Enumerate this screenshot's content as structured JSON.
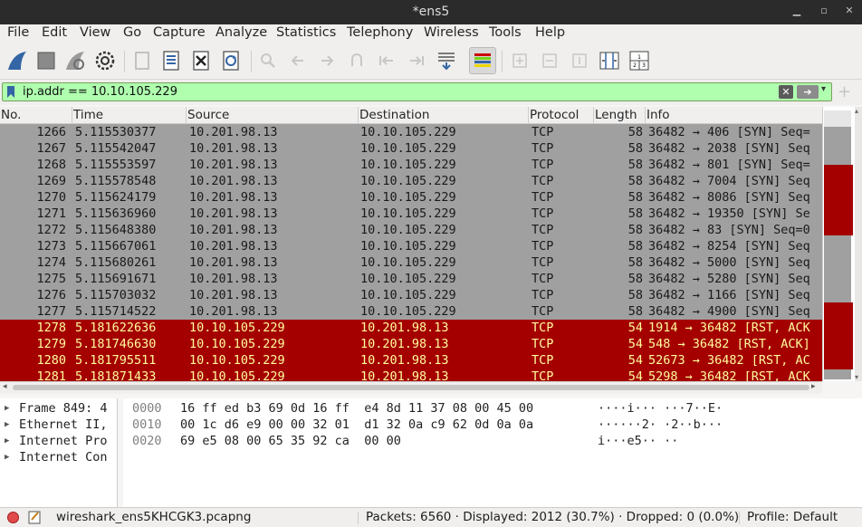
{
  "window": {
    "title": "*ens5"
  },
  "menu": [
    "File",
    "Edit",
    "View",
    "Go",
    "Capture",
    "Analyze",
    "Statistics",
    "Telephony",
    "Wireless",
    "Tools",
    "Help"
  ],
  "filter": {
    "value": "ip.addr == 10.10.105.229"
  },
  "columns": [
    "No.",
    "Time",
    "Source",
    "Destination",
    "Protocol",
    "Length",
    "Info"
  ],
  "packets": [
    {
      "no": "1266",
      "time": "5.115530377",
      "src": "10.201.98.13",
      "dst": "10.10.105.229",
      "proto": "TCP",
      "len": "58",
      "info": "36482 → 406 [SYN] Seq=",
      "type": "syn"
    },
    {
      "no": "1267",
      "time": "5.115542047",
      "src": "10.201.98.13",
      "dst": "10.10.105.229",
      "proto": "TCP",
      "len": "58",
      "info": "36482 → 2038 [SYN] Seq",
      "type": "syn"
    },
    {
      "no": "1268",
      "time": "5.115553597",
      "src": "10.201.98.13",
      "dst": "10.10.105.229",
      "proto": "TCP",
      "len": "58",
      "info": "36482 → 801 [SYN] Seq=",
      "type": "syn"
    },
    {
      "no": "1269",
      "time": "5.115578548",
      "src": "10.201.98.13",
      "dst": "10.10.105.229",
      "proto": "TCP",
      "len": "58",
      "info": "36482 → 7004 [SYN] Seq",
      "type": "syn"
    },
    {
      "no": "1270",
      "time": "5.115624179",
      "src": "10.201.98.13",
      "dst": "10.10.105.229",
      "proto": "TCP",
      "len": "58",
      "info": "36482 → 8086 [SYN] Seq",
      "type": "syn"
    },
    {
      "no": "1271",
      "time": "5.115636960",
      "src": "10.201.98.13",
      "dst": "10.10.105.229",
      "proto": "TCP",
      "len": "58",
      "info": "36482 → 19350 [SYN] Se",
      "type": "syn"
    },
    {
      "no": "1272",
      "time": "5.115648380",
      "src": "10.201.98.13",
      "dst": "10.10.105.229",
      "proto": "TCP",
      "len": "58",
      "info": "36482 → 83 [SYN] Seq=0",
      "type": "syn"
    },
    {
      "no": "1273",
      "time": "5.115667061",
      "src": "10.201.98.13",
      "dst": "10.10.105.229",
      "proto": "TCP",
      "len": "58",
      "info": "36482 → 8254 [SYN] Seq",
      "type": "syn"
    },
    {
      "no": "1274",
      "time": "5.115680261",
      "src": "10.201.98.13",
      "dst": "10.10.105.229",
      "proto": "TCP",
      "len": "58",
      "info": "36482 → 5000 [SYN] Seq",
      "type": "syn"
    },
    {
      "no": "1275",
      "time": "5.115691671",
      "src": "10.201.98.13",
      "dst": "10.10.105.229",
      "proto": "TCP",
      "len": "58",
      "info": "36482 → 5280 [SYN] Seq",
      "type": "syn"
    },
    {
      "no": "1276",
      "time": "5.115703032",
      "src": "10.201.98.13",
      "dst": "10.10.105.229",
      "proto": "TCP",
      "len": "58",
      "info": "36482 → 1166 [SYN] Seq",
      "type": "syn"
    },
    {
      "no": "1277",
      "time": "5.115714522",
      "src": "10.201.98.13",
      "dst": "10.10.105.229",
      "proto": "TCP",
      "len": "58",
      "info": "36482 → 4900 [SYN] Seq",
      "type": "syn"
    },
    {
      "no": "1278",
      "time": "5.181622636",
      "src": "10.10.105.229",
      "dst": "10.201.98.13",
      "proto": "TCP",
      "len": "54",
      "info": "1914 → 36482 [RST, ACK",
      "type": "rst"
    },
    {
      "no": "1279",
      "time": "5.181746630",
      "src": "10.10.105.229",
      "dst": "10.201.98.13",
      "proto": "TCP",
      "len": "54",
      "info": "548 → 36482 [RST, ACK]",
      "type": "rst"
    },
    {
      "no": "1280",
      "time": "5.181795511",
      "src": "10.10.105.229",
      "dst": "10.201.98.13",
      "proto": "TCP",
      "len": "54",
      "info": "52673 → 36482 [RST, AC",
      "type": "rst"
    },
    {
      "no": "1281",
      "time": "5.181871433",
      "src": "10.10.105.229",
      "dst": "10.201.98.13",
      "proto": "TCP",
      "len": "54",
      "info": "5298 → 36482 [RST, ACK",
      "type": "rst"
    }
  ],
  "details": [
    "Frame 849: 4",
    "Ethernet II,",
    "Internet Pro",
    "Internet Con"
  ],
  "bytes": [
    {
      "offset": "0000",
      "hex": "16 ff ed b3 69 0d 16 ff  e4 8d 11 37 08 00 45 00",
      "ascii": "····i··· ···7··E·"
    },
    {
      "offset": "0010",
      "hex": "00 1c d6 e9 00 00 32 01  d1 32 0a c9 62 0d 0a 0a",
      "ascii": "······2· ·2··b···"
    },
    {
      "offset": "0020",
      "hex": "69 e5 08 00 65 35 92 ca  00 00",
      "ascii": "i···e5·· ··"
    }
  ],
  "status": {
    "file": "wireshark_ens5KHCGK3.pcapng",
    "packets": "Packets: 6560 · Displayed: 2012 (30.7%) · Dropped: 0 (0.0%)",
    "profile": "Profile: Default"
  },
  "colors": {
    "syn_row": "#a0a0a0",
    "rst_row": "#a40000",
    "rst_text": "#fffc9c",
    "filter_ok": "#afffaf"
  }
}
